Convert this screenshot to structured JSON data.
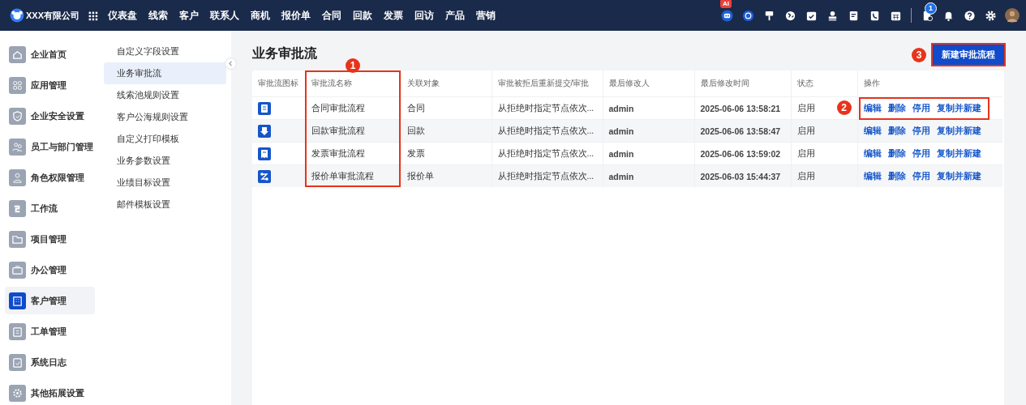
{
  "top_bar": {
    "company": "XXX有限公司",
    "nav": [
      {
        "label": "仪表盘"
      },
      {
        "label": "线索"
      },
      {
        "label": "客户"
      },
      {
        "label": "联系人"
      },
      {
        "label": "商机"
      },
      {
        "label": "报价单"
      },
      {
        "label": "合同"
      },
      {
        "label": "回款"
      },
      {
        "label": "发票"
      },
      {
        "label": "回访"
      },
      {
        "label": "产品"
      },
      {
        "label": "营销"
      }
    ],
    "ai_badge": "AI",
    "notification_badge": "1"
  },
  "sidebar": {
    "items": [
      {
        "label": "企业首页",
        "selected": false
      },
      {
        "label": "应用管理",
        "selected": false
      },
      {
        "label": "企业安全设置",
        "selected": false
      },
      {
        "label": "员工与部门管理",
        "selected": false
      },
      {
        "label": "角色权限管理",
        "selected": false
      },
      {
        "label": "工作流",
        "selected": false
      },
      {
        "label": "项目管理",
        "selected": false
      },
      {
        "label": "办公管理",
        "selected": false
      },
      {
        "label": "客户管理",
        "selected": true
      },
      {
        "label": "工单管理",
        "selected": false
      },
      {
        "label": "系统日志",
        "selected": false
      },
      {
        "label": "其他拓展设置",
        "selected": false
      }
    ]
  },
  "submenu": {
    "items": [
      {
        "label": "自定义字段设置",
        "selected": false
      },
      {
        "label": "业务审批流",
        "selected": true
      },
      {
        "label": "线索池规则设置",
        "selected": false
      },
      {
        "label": "客户公海规则设置",
        "selected": false
      },
      {
        "label": "自定义打印模板",
        "selected": false
      },
      {
        "label": "业务参数设置",
        "selected": false
      },
      {
        "label": "业绩目标设置",
        "selected": false
      },
      {
        "label": "邮件模板设置",
        "selected": false
      }
    ]
  },
  "page": {
    "title": "业务审批流",
    "new_button": "新建审批流程"
  },
  "table": {
    "columns": [
      "审批流图标",
      "审批流名称",
      "关联对象",
      "审批被拒后重新提交/审批",
      "最后修改人",
      "最后修改时间",
      "状态",
      "操作"
    ],
    "rows": [
      {
        "name": "合同审批流程",
        "object": "合同",
        "resubmit": "从拒绝时指定节点依次...",
        "modifier": "admin",
        "time": "2025-06-06 13:58:21",
        "status": "启用",
        "actions": [
          "编辑",
          "删除",
          "停用",
          "复制并新建"
        ]
      },
      {
        "name": "回款审批流程",
        "object": "回款",
        "resubmit": "从拒绝时指定节点依次...",
        "modifier": "admin",
        "time": "2025-06-06 13:58:47",
        "status": "启用",
        "actions": [
          "编辑",
          "删除",
          "停用",
          "复制并新建"
        ]
      },
      {
        "name": "发票审批流程",
        "object": "发票",
        "resubmit": "从拒绝时指定节点依次...",
        "modifier": "admin",
        "time": "2025-06-06 13:59:02",
        "status": "启用",
        "actions": [
          "编辑",
          "删除",
          "停用",
          "复制并新建"
        ]
      },
      {
        "name": "报价单审批流程",
        "object": "报价单",
        "resubmit": "从拒绝时指定节点依次...",
        "modifier": "admin",
        "time": "2025-06-03 15:44:37",
        "status": "启用",
        "actions": [
          "编辑",
          "删除",
          "停用",
          "复制并新建"
        ]
      }
    ]
  },
  "annotations": [
    {
      "number": "1",
      "kind": "column_frame"
    },
    {
      "number": "2",
      "kind": "row_frame"
    },
    {
      "number": "3",
      "kind": "button_frame"
    }
  ]
}
